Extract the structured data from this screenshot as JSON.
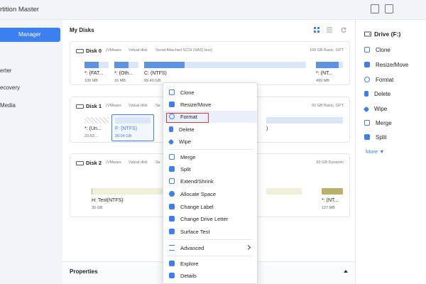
{
  "app": {
    "title": "rtition Master"
  },
  "colors": {
    "accent": "#3b7ff0",
    "partition_fill": "#5e93e0",
    "partition_bg": "#dbe6f6",
    "highlight_box": "#e0372f"
  },
  "sidebar": {
    "items": [
      {
        "label": "Manager",
        "active": true
      },
      {
        "label": "erter"
      },
      {
        "label": "ecovery"
      },
      {
        "label": "Media"
      }
    ]
  },
  "main": {
    "title": "My Disks"
  },
  "disks": [
    {
      "name": "Disk 0",
      "type": "(VMware",
      "kind": "Virtual disk",
      "bus": "Serial Attached SCSI (SAS) bus)",
      "size": "100 GB Basic, GPT",
      "partitions": [
        {
          "name": "*: (FAT...",
          "size": "100 MB",
          "used": 0.6
        },
        {
          "name": "*: (Oth...",
          "size": "16 MB",
          "used": 0.6
        },
        {
          "name": "C: (NTFS)",
          "size": "99.40 GB",
          "used": 0.25
        },
        {
          "name": "*: (NT...",
          "size": "499 MB",
          "used": 0.85
        }
      ]
    },
    {
      "name": "Disk 1",
      "type": "(VMware",
      "kind": "Virtual disk",
      "bus": "Se",
      "size": "60 GB Basic, GPT",
      "partitions": [
        {
          "name": "*: (Un...",
          "size": "23.53 ..."
        },
        {
          "name": "F: (NTFS)",
          "size": "30.04 GB"
        },
        {
          "name": ")",
          "size": ""
        }
      ]
    },
    {
      "name": "Disk 2",
      "type": "(VMware",
      "kind": "Virtual disk",
      "bus": "Se",
      "size": "60 GB Dynamic",
      "partitions": [
        {
          "name": "H: Test(NTFS)",
          "size": "30 GB"
        },
        {
          "name": "*: (NT...",
          "size": "127 MB"
        }
      ]
    }
  ],
  "properties": {
    "title": "Properties"
  },
  "right_panel": {
    "drive": "Drive (F:)",
    "actions": [
      "Clone",
      "Resize/Move",
      "Format",
      "Delete",
      "Wipe",
      "Merge",
      "Split"
    ],
    "more": "More ▼"
  },
  "context_menu": {
    "items": [
      {
        "label": "Clone",
        "icon": "clone-icon"
      },
      {
        "label": "Resize/Move",
        "icon": "resize-icon"
      },
      {
        "label": "Format",
        "icon": "format-icon",
        "highlighted": true
      },
      {
        "label": "Delete",
        "icon": "trash-icon"
      },
      {
        "label": "Wipe",
        "icon": "eraser-icon"
      },
      {
        "label": "Merge",
        "icon": "merge-icon"
      },
      {
        "label": "Split",
        "icon": "split-icon"
      },
      {
        "label": "Extend/Shrink",
        "icon": "extend-icon"
      },
      {
        "label": "Allocate Space",
        "icon": "pie-icon"
      },
      {
        "label": "Change Label",
        "icon": "label-icon"
      },
      {
        "label": "Change Drive Letter",
        "icon": "letter-icon"
      },
      {
        "label": "Surface Test",
        "icon": "test-icon"
      },
      {
        "label": "Advanced",
        "icon": "sliders-icon"
      },
      {
        "label": "Explore",
        "icon": "folder-icon"
      },
      {
        "label": "Details",
        "icon": "details-icon"
      }
    ]
  }
}
